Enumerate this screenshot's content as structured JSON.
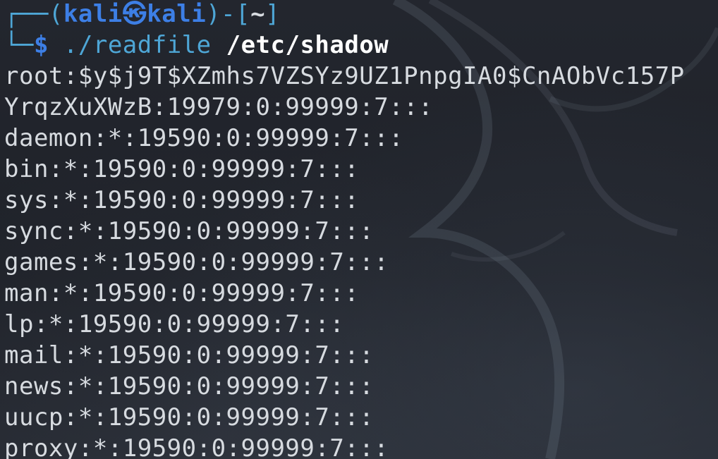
{
  "prompt": {
    "box_top": "┌──(",
    "user": "kali",
    "at_symbol": "㉿",
    "host": "kali",
    "sep_open": ")-[",
    "cwd": "~",
    "sep_close": "]",
    "box_bottom": "└─",
    "dollar": "$",
    "command": "./readfile",
    "argument": "/etc/shadow"
  },
  "output_lines": [
    "root:$y$j9T$XZmhs7VZSYz9UZ1PnpgIA0$CnAObVc157P",
    "YrqzXuXWzB:19979:0:99999:7:::",
    "daemon:*:19590:0:99999:7:::",
    "bin:*:19590:0:99999:7:::",
    "sys:*:19590:0:99999:7:::",
    "sync:*:19590:0:99999:7:::",
    "games:*:19590:0:99999:7:::",
    "man:*:19590:0:99999:7:::",
    "lp:*:19590:0:99999:7:::",
    "mail:*:19590:0:99999:7:::",
    "news:*:19590:0:99999:7:::",
    "uucp:*:19590:0:99999:7:::",
    "proxy:*:19590:0:99999:7:::"
  ],
  "colors": {
    "background": "#20232b",
    "prompt_accent": "#3d7fe6",
    "box_chars": "#4ea6d6",
    "text": "#d7dbe0"
  }
}
